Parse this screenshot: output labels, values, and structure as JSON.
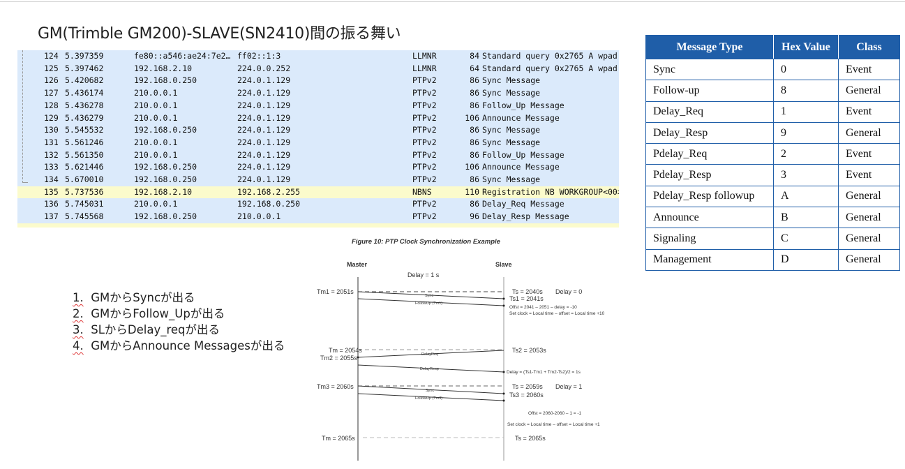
{
  "title": "GM(Trimble GM200)-SLAVE(SN2410)間の振る舞い",
  "packets": [
    {
      "no": "124",
      "time": "5.397359",
      "src": "fe80::a546:ae24:7e2…",
      "dst": "ff02::1:3",
      "proto": "LLMNR",
      "len": "84",
      "info": "Standard query 0x2765 A wpad"
    },
    {
      "no": "125",
      "time": "5.397462",
      "src": "192.168.2.10",
      "dst": "224.0.0.252",
      "proto": "LLMNR",
      "len": "64",
      "info": "Standard query 0x2765 A wpad"
    },
    {
      "no": "126",
      "time": "5.420682",
      "src": "192.168.0.250",
      "dst": "224.0.1.129",
      "proto": "PTPv2",
      "len": "86",
      "info": "Sync Message"
    },
    {
      "no": "127",
      "time": "5.436174",
      "src": "210.0.0.1",
      "dst": "224.0.1.129",
      "proto": "PTPv2",
      "len": "86",
      "info": "Sync Message"
    },
    {
      "no": "128",
      "time": "5.436278",
      "src": "210.0.0.1",
      "dst": "224.0.1.129",
      "proto": "PTPv2",
      "len": "86",
      "info": "Follow_Up Message"
    },
    {
      "no": "129",
      "time": "5.436279",
      "src": "210.0.0.1",
      "dst": "224.0.1.129",
      "proto": "PTPv2",
      "len": "106",
      "info": "Announce Message"
    },
    {
      "no": "130",
      "time": "5.545532",
      "src": "192.168.0.250",
      "dst": "224.0.1.129",
      "proto": "PTPv2",
      "len": "86",
      "info": "Sync Message"
    },
    {
      "no": "131",
      "time": "5.561246",
      "src": "210.0.0.1",
      "dst": "224.0.1.129",
      "proto": "PTPv2",
      "len": "86",
      "info": "Sync Message"
    },
    {
      "no": "132",
      "time": "5.561350",
      "src": "210.0.0.1",
      "dst": "224.0.1.129",
      "proto": "PTPv2",
      "len": "86",
      "info": "Follow_Up Message"
    },
    {
      "no": "133",
      "time": "5.621446",
      "src": "192.168.0.250",
      "dst": "224.0.1.129",
      "proto": "PTPv2",
      "len": "106",
      "info": "Announce Message"
    },
    {
      "no": "134",
      "time": "5.670010",
      "src": "192.168.0.250",
      "dst": "224.0.1.129",
      "proto": "PTPv2",
      "len": "86",
      "info": "Sync Message"
    },
    {
      "no": "135",
      "time": "5.737536",
      "src": "192.168.2.10",
      "dst": "192.168.2.255",
      "proto": "NBNS",
      "len": "110",
      "info": "Registration NB WORKGROUP<00>",
      "highlight": true
    },
    {
      "no": "136",
      "time": "5.745031",
      "src": "210.0.0.1",
      "dst": "192.168.0.250",
      "proto": "PTPv2",
      "len": "86",
      "info": "Delay_Req Message"
    },
    {
      "no": "137",
      "time": "5.745568",
      "src": "192.168.0.250",
      "dst": "210.0.0.1",
      "proto": "PTPv2",
      "len": "96",
      "info": "Delay_Resp Message"
    }
  ],
  "msg_table": {
    "headers": [
      "Message Type",
      "Hex Value",
      "Class"
    ],
    "rows": [
      [
        "Sync",
        "0",
        "Event"
      ],
      [
        "Follow-up",
        "8",
        "General"
      ],
      [
        "Delay_Req",
        "1",
        "Event"
      ],
      [
        "Delay_Resp",
        "9",
        "General"
      ],
      [
        "Pdelay_Req",
        "2",
        "Event"
      ],
      [
        "Pdelay_Resp",
        "3",
        "Event"
      ],
      [
        "Pdelay_Resp followup",
        "A",
        "General"
      ],
      [
        "Announce",
        "B",
        "General"
      ],
      [
        "Signaling",
        "C",
        "General"
      ],
      [
        "Management",
        "D",
        "General"
      ]
    ],
    "header_color": "#1f5ea8"
  },
  "steps": [
    {
      "num": "1.",
      "text": "GMからSyncが出る"
    },
    {
      "num": "2.",
      "text": "GMからFollow_Upが出る"
    },
    {
      "num": "3.",
      "text": "SLからDelay_reqが出る"
    },
    {
      "num": "4.",
      "text": "GMからAnnounce Messagesが出る"
    }
  ],
  "figure": {
    "caption": "Figure 10: PTP Clock Synchronization Example",
    "master": "Master",
    "slave": "Slave",
    "delay": "Delay = 1 s",
    "tm1": "Tm1 = 2051s",
    "ts0": "Ts = 2040s",
    "delay0": "Delay = 0",
    "ts1": "Ts1 = 2041s",
    "sync": "Sync",
    "followup1": "FollowUp (Tm1)",
    "offset1": "Offst = 2041 – 2051 – delay = -10",
    "setclock1": "Set clock = Local time – offset = Local time +10",
    "tm2054": "Tm = 2054s",
    "tm2": "Tm2 = 2055s",
    "ts2": "Ts2 = 2053s",
    "delayreq": "DelayReq",
    "delayresp": "DelayResp",
    "delaycalc": "Delay = (Ts1-Tm1 + Tm2-Ts2)/2 = 1s",
    "tm3": "Tm3 = 2060s",
    "ts2059": "Ts = 2059s",
    "delay1": "Delay = 1",
    "ts3": "Ts3 = 2060s",
    "sync2": "Sync",
    "followup3": "FollowUp (Tm3)",
    "offset2": "Offst = 2060-2060 – 1 = -1",
    "setclock2": "Set clock = Local time – offset = Local time +1",
    "tm2065": "Tm = 2065s",
    "ts2065": "Ts = 2065s"
  }
}
